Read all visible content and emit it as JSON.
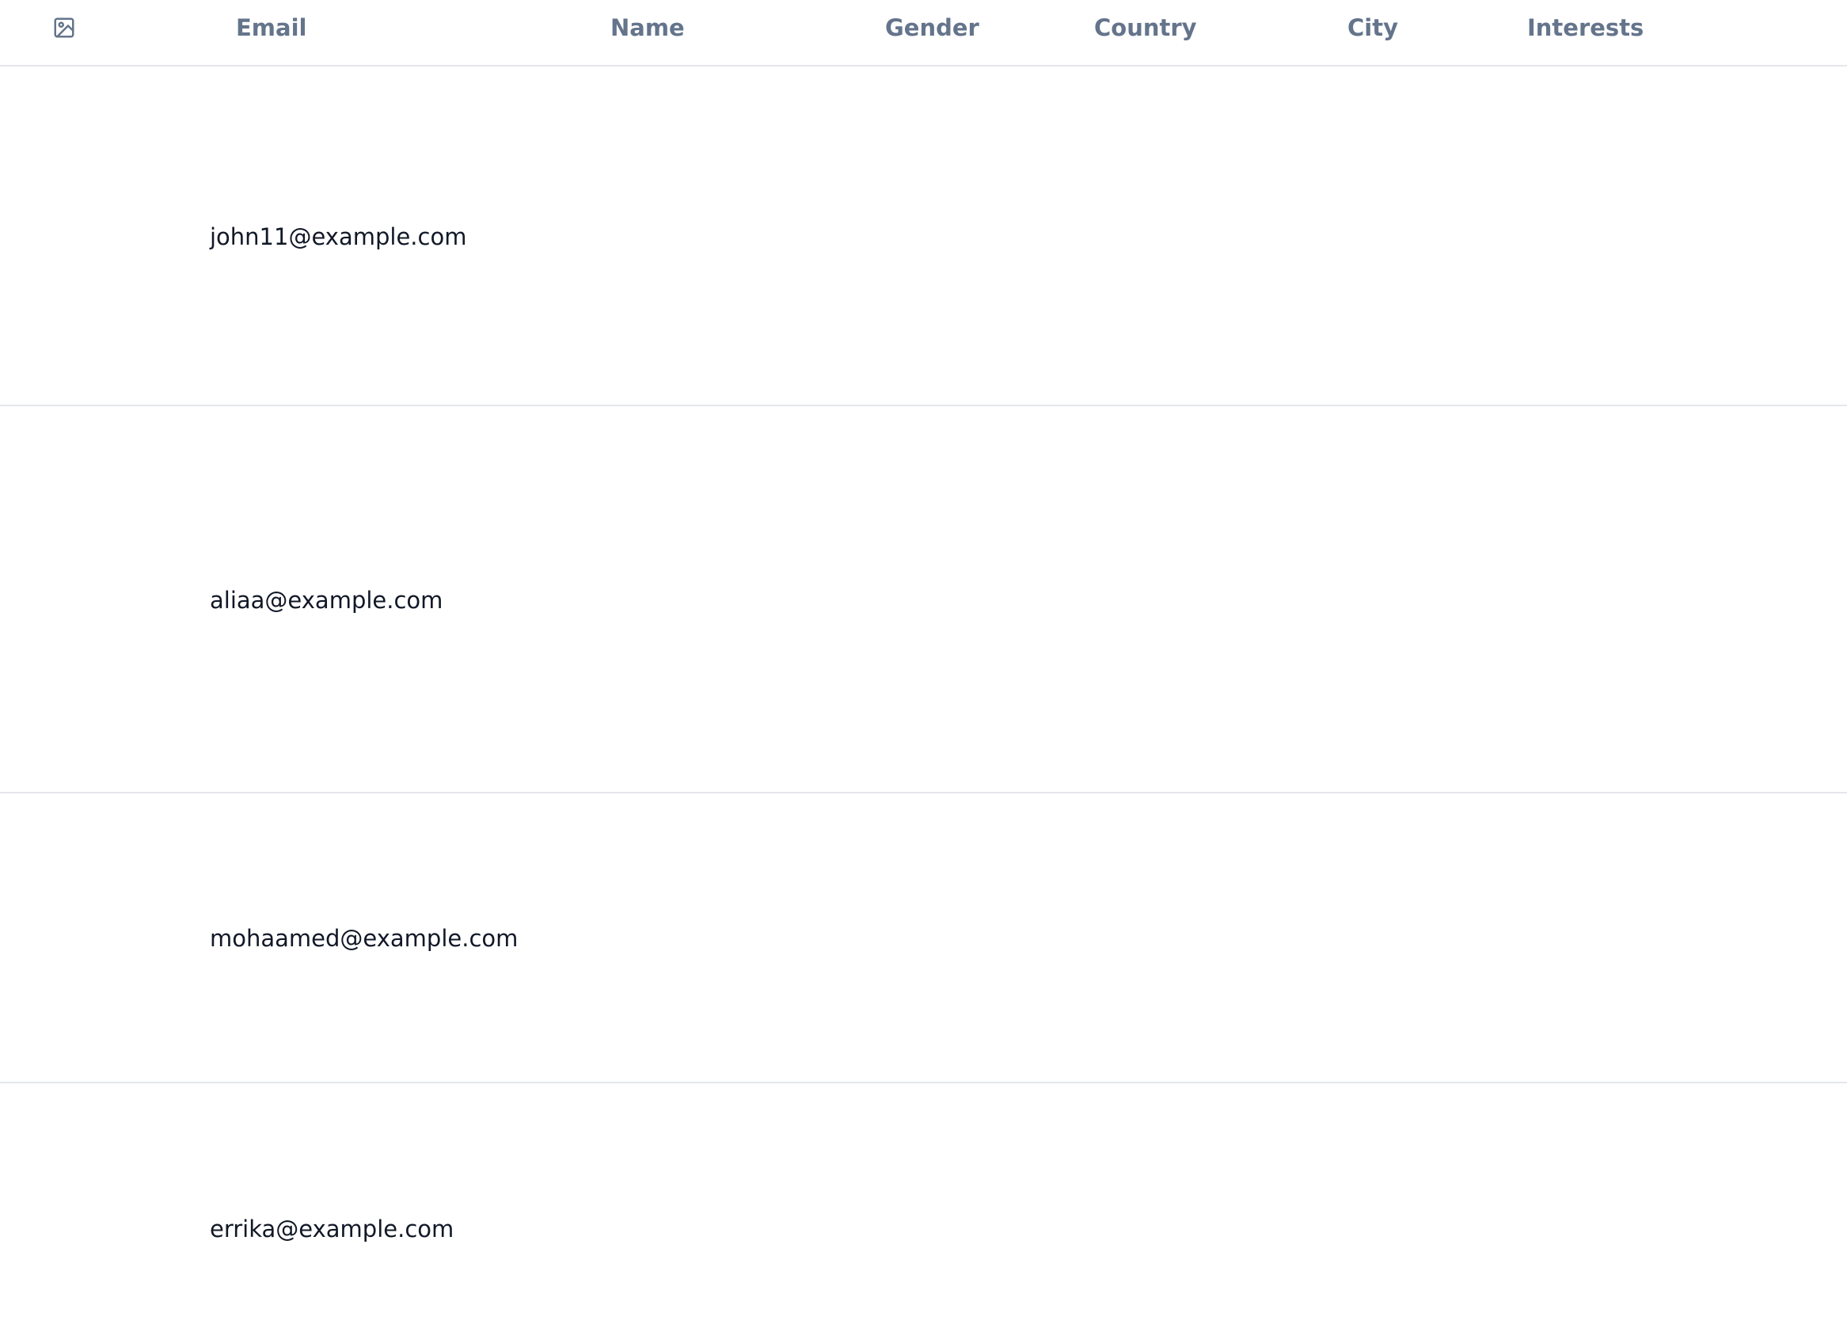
{
  "table": {
    "columns": [
      {
        "key": "image",
        "label": "",
        "icon": "image-icon"
      },
      {
        "key": "email",
        "label": "Email"
      },
      {
        "key": "name",
        "label": "Name"
      },
      {
        "key": "gender",
        "label": "Gender"
      },
      {
        "key": "country",
        "label": "Country"
      },
      {
        "key": "city",
        "label": "City"
      },
      {
        "key": "interests",
        "label": "Interests"
      }
    ],
    "rows": [
      {
        "email": "john11@example.com"
      },
      {
        "email": "aliaa@example.com"
      },
      {
        "email": "mohaamed@example.com"
      },
      {
        "email": "errika@example.com"
      }
    ]
  },
  "colors": {
    "header_text": "#64748b",
    "cell_text": "#111827",
    "divider": "#e5e7eb"
  }
}
